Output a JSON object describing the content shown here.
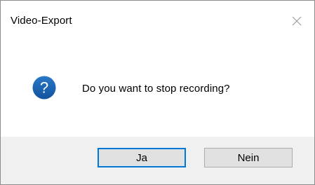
{
  "dialog": {
    "title": "Video-Export",
    "message": "Do you want to stop recording?",
    "icon": "question-icon",
    "close_icon": "close-icon"
  },
  "buttons": {
    "yes_label": "Ja",
    "no_label": "Nein",
    "default": "yes"
  },
  "colors": {
    "accent": "#0078d7",
    "question_icon": "#1c64b5",
    "footer_bg": "#f0f0f0",
    "button_bg": "#e1e1e1"
  }
}
